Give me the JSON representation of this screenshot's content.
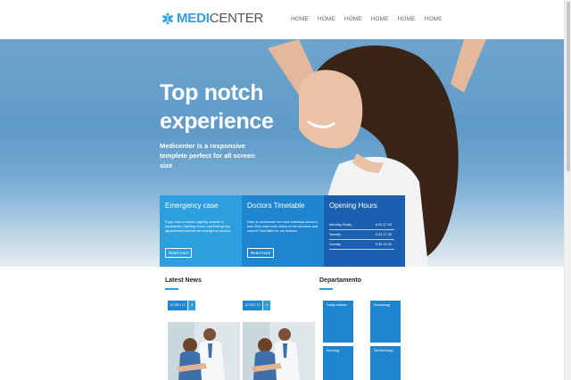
{
  "header": {
    "logo_part1": "MEDI",
    "logo_part2": "CENTER",
    "nav": [
      "HOME",
      "HOME",
      "HOME",
      "HOME",
      "HOME",
      "HOME"
    ]
  },
  "hero": {
    "title_line1": "Top notch",
    "title_line2": "experience",
    "subtitle_line1": "Medicenter is a responsive",
    "subtitle_line2": "templete perfect for all screen size"
  },
  "boxes": {
    "emergency": {
      "title": "Emergency case",
      "text": "If you need a doctor urgently outside of medicenter Opening hours, call Emergency appointment number for emergency service.",
      "button": "Read more"
    },
    "timetable": {
      "title": "Doctors Timetable",
      "text": "Here at medicenter we have individual doctor's lists.Click read more below to see services and current TimeTable for our doctors.",
      "button": "Read more"
    },
    "hours": {
      "title": "Opening Hours",
      "rows": [
        {
          "day": "Monday-Friday",
          "time": "8.00-17.00"
        },
        {
          "day": "Saturdy",
          "time": "9.30-17.30"
        },
        {
          "day": "Sunday",
          "time": "9.30-15.00"
        }
      ]
    }
  },
  "news": {
    "title": "Latest News",
    "items": [
      {
        "date": "10 DEC 12",
        "count": "3"
      },
      {
        "date": "10 DEC 12",
        "count": "3"
      }
    ]
  },
  "departments": {
    "title": "Departamento",
    "items": [
      "Family medicine",
      "Dermatology",
      "Neurology",
      "Ophthalmology"
    ]
  },
  "colors": {
    "accent": "#2e9fde",
    "primary": "#1f85cf",
    "dark": "#1a5fb0"
  }
}
